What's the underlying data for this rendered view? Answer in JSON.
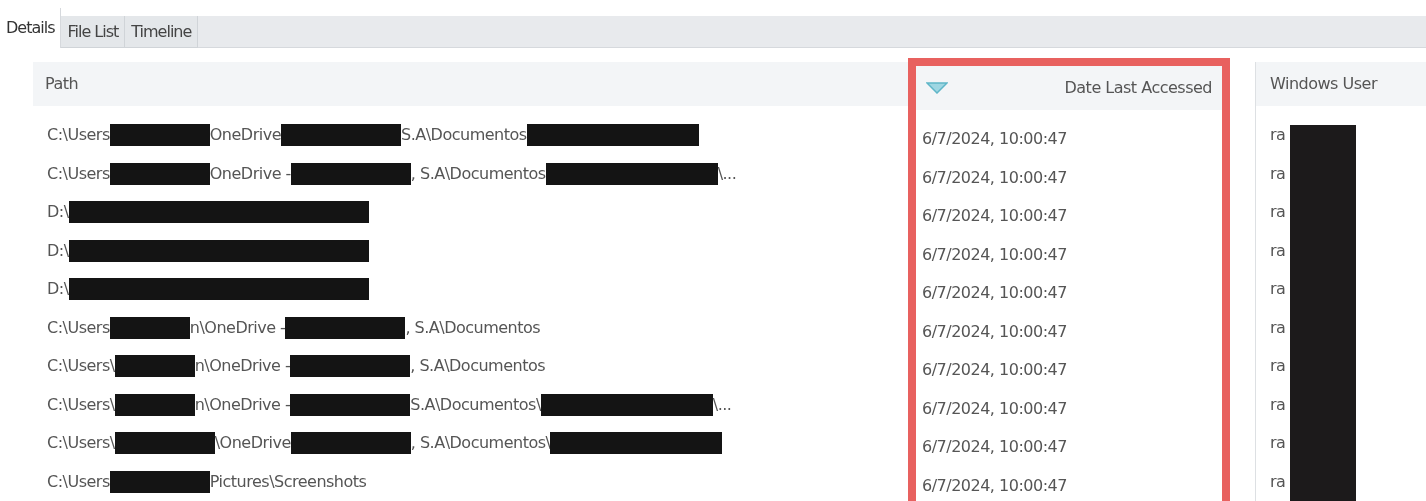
{
  "tabs": [
    {
      "label": "Details",
      "selected": true
    },
    {
      "label": "File List",
      "selected": false
    },
    {
      "label": "Timeline",
      "selected": false
    }
  ],
  "columns": [
    {
      "label": "Path",
      "sorted": false,
      "highlighted": false
    },
    {
      "label": "Date Last Accessed",
      "sorted": true,
      "highlighted": true
    },
    {
      "label": "Windows User",
      "sorted": false,
      "highlighted": false
    }
  ],
  "rows": [
    {
      "path": [
        {
          "kind": "text",
          "text": "C:\\Users"
        },
        {
          "kind": "name"
        },
        {
          "kind": "text",
          "text": "OneDrive "
        },
        {
          "kind": "org"
        },
        {
          "kind": "text",
          "text": " S.A\\Documentos"
        },
        {
          "kind": "folder"
        }
      ],
      "date": "6/7/2024, 10:00:47",
      "user": "ra"
    },
    {
      "path": [
        {
          "kind": "text",
          "text": "C:\\Users "
        },
        {
          "kind": "name"
        },
        {
          "kind": "text",
          "text": "OneDrive -"
        },
        {
          "kind": "org"
        },
        {
          "kind": "text",
          "text": ", S.A\\Documentos"
        },
        {
          "kind": "folder"
        },
        {
          "kind": "text",
          "text": "\\..."
        }
      ],
      "date": "6/7/2024, 10:00:47",
      "user": "ra"
    },
    {
      "path": [
        {
          "kind": "text",
          "text": "D:\\"
        },
        {
          "kind": "drive"
        }
      ],
      "date": "6/7/2024, 10:00:47",
      "user": "ra"
    },
    {
      "path": [
        {
          "kind": "text",
          "text": "D:\\"
        },
        {
          "kind": "drive"
        }
      ],
      "date": "6/7/2024, 10:00:47",
      "user": "ra"
    },
    {
      "path": [
        {
          "kind": "text",
          "text": "D:\\"
        },
        {
          "kind": "drive"
        }
      ],
      "date": "6/7/2024, 10:00:47",
      "user": "ra"
    },
    {
      "path": [
        {
          "kind": "text",
          "text": "C:\\Users"
        },
        {
          "kind": "short"
        },
        {
          "kind": "text",
          "text": "n\\OneDrive -"
        },
        {
          "kind": "org"
        },
        {
          "kind": "text",
          "text": ", S.A\\Documentos"
        }
      ],
      "date": "6/7/2024, 10:00:47",
      "user": "ra"
    },
    {
      "path": [
        {
          "kind": "text",
          "text": "C:\\Users\\"
        },
        {
          "kind": "short"
        },
        {
          "kind": "text",
          "text": "n\\OneDrive -"
        },
        {
          "kind": "org"
        },
        {
          "kind": "text",
          "text": ", S.A\\Documentos"
        }
      ],
      "date": "6/7/2024, 10:00:47",
      "user": "ra"
    },
    {
      "path": [
        {
          "kind": "text",
          "text": "C:\\Users\\"
        },
        {
          "kind": "short"
        },
        {
          "kind": "text",
          "text": "n\\OneDrive -"
        },
        {
          "kind": "org"
        },
        {
          "kind": "text",
          "text": " S.A\\Documentos\\"
        },
        {
          "kind": "folder"
        },
        {
          "kind": "text",
          "text": "\\..."
        }
      ],
      "date": "6/7/2024, 10:00:47",
      "user": "ra"
    },
    {
      "path": [
        {
          "kind": "text",
          "text": "C:\\Users\\"
        },
        {
          "kind": "name"
        },
        {
          "kind": "text",
          "text": "\\OneDrive "
        },
        {
          "kind": "org"
        },
        {
          "kind": "text",
          "text": ", S.A\\Documentos\\"
        },
        {
          "kind": "folder"
        }
      ],
      "date": "6/7/2024, 10:00:47",
      "user": "ra"
    },
    {
      "path": [
        {
          "kind": "text",
          "text": "C:\\Users"
        },
        {
          "kind": "name"
        },
        {
          "kind": "text",
          "text": "Pictures\\Screenshots"
        }
      ],
      "date": "6/7/2024, 10:00:47",
      "user": "ra"
    }
  ]
}
